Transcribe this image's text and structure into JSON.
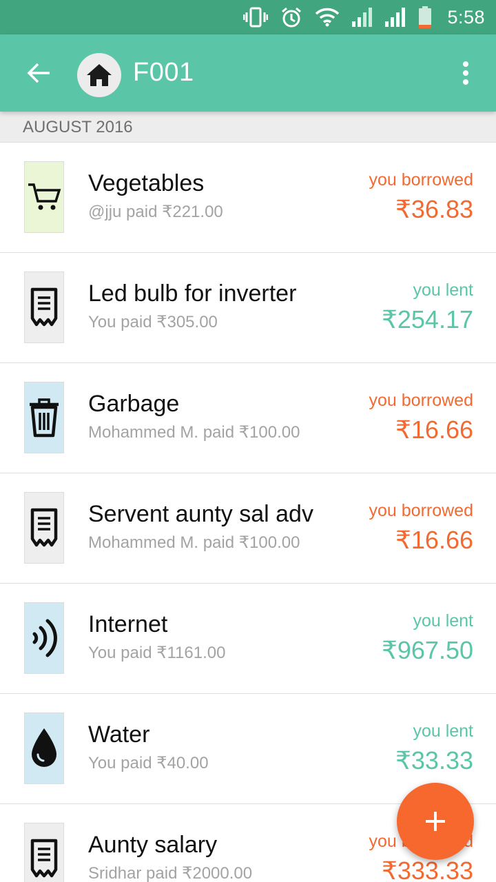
{
  "status_bar": {
    "time": "5:58",
    "icons": [
      "vibrate-icon",
      "alarm-icon",
      "wifi-icon",
      "signal-icon",
      "signal-icon",
      "battery-icon"
    ]
  },
  "app_bar": {
    "title": "F001",
    "back_icon": "arrow-left-icon",
    "avatar_icon": "home-icon",
    "menu_icon": "more-vertical-icon"
  },
  "section": {
    "header": "AUGUST 2016"
  },
  "expenses": [
    {
      "title": "Vegetables",
      "subtitle": "@jju paid ₹221.00",
      "status": "you borrowed",
      "amount": "₹36.83",
      "icon": "shopping-cart-icon",
      "icon_bg": "#eaf6d6",
      "tone": "orange"
    },
    {
      "title": "Led bulb for inverter",
      "subtitle": "You paid ₹305.00",
      "status": "you lent",
      "amount": "₹254.17",
      "icon": "receipt-icon",
      "icon_bg": "#eeeeee",
      "tone": "teal"
    },
    {
      "title": "Garbage",
      "subtitle": "Mohammed M. paid ₹100.00",
      "status": "you borrowed",
      "amount": "₹16.66",
      "icon": "trash-icon",
      "icon_bg": "#d1e9f2",
      "tone": "orange"
    },
    {
      "title": "Servent aunty sal adv",
      "subtitle": "Mohammed M. paid ₹100.00",
      "status": "you borrowed",
      "amount": "₹16.66",
      "icon": "receipt-icon",
      "icon_bg": "#eeeeee",
      "tone": "orange"
    },
    {
      "title": "Internet",
      "subtitle": "You paid ₹1161.00",
      "status": "you lent",
      "amount": "₹967.50",
      "icon": "signal-waves-icon",
      "icon_bg": "#d1e9f2",
      "tone": "teal"
    },
    {
      "title": "Water",
      "subtitle": "You paid ₹40.00",
      "status": "you lent",
      "amount": "₹33.33",
      "icon": "water-drop-icon",
      "icon_bg": "#d1e9f2",
      "tone": "teal"
    },
    {
      "title": "Aunty salary",
      "subtitle": "Sridhar paid ₹2000.00",
      "status": "you borrowed",
      "amount": "₹333.33",
      "icon": "receipt-icon",
      "icon_bg": "#eeeeee",
      "tone": "orange"
    }
  ],
  "fab": {
    "label": "+",
    "icon": "plus-icon"
  },
  "colors": {
    "status_bar": "#41a57f",
    "app_bar": "#5bc5a7",
    "borrowed": "#f26a32",
    "lent": "#5bc5a7",
    "fab": "#f7682f"
  }
}
